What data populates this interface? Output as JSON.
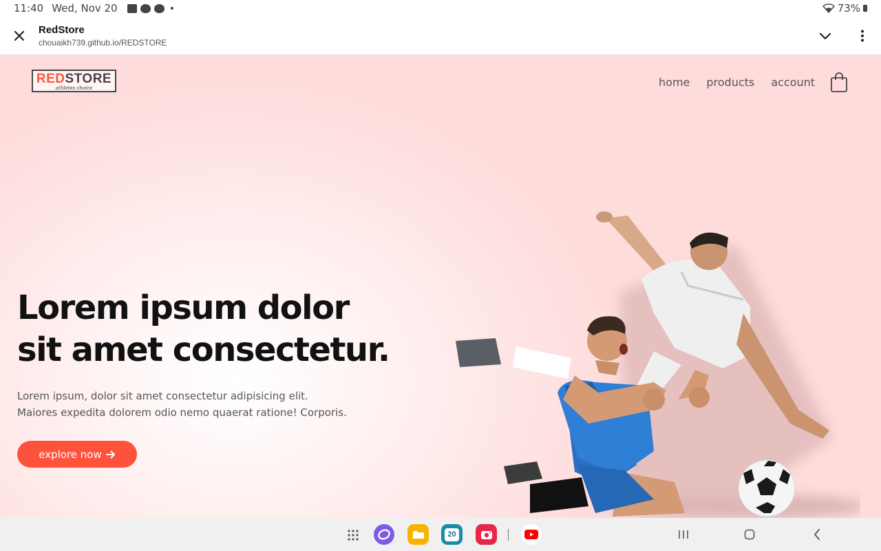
{
  "status_bar": {
    "time": "11:40",
    "date": "Wed, Nov 20",
    "notification_icons": [
      "gallery-icon",
      "weather-icon",
      "cloud-icon"
    ],
    "battery": "73%"
  },
  "browser": {
    "page_title": "RedStore",
    "url": "chouaikh739.github.io/REDSTORE"
  },
  "site": {
    "logo": {
      "part1": "RED",
      "part2": "STORE",
      "tagline": "athletes choice"
    },
    "nav": {
      "home": "home",
      "products": "products",
      "account": "account"
    },
    "hero": {
      "title_line1": "Lorem ipsum dolor",
      "title_line2": "sit amet consectetur.",
      "text_line1": "Lorem ipsum, dolor sit amet consectetur adipisicing elit.",
      "text_line2": "Maiores expedita dolorem odio nemo quaerat ratione! Corporis.",
      "button_label": "explore now"
    }
  },
  "nav_bar": {
    "calendar_day": "20",
    "apps": [
      "apps-grid-icon",
      "internet-icon",
      "files-icon",
      "calendar-icon",
      "camera-icon",
      "youtube-icon"
    ]
  },
  "colors": {
    "brand_red": "#ff523b",
    "hero_bg": "#ffdcdc",
    "title": "#111111"
  }
}
